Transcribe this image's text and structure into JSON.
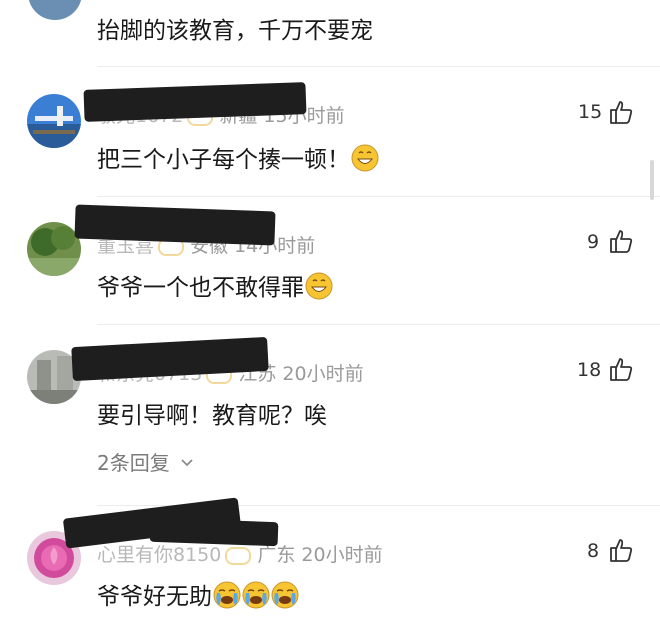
{
  "prev_comment": {
    "text": "抬脚的该教育，千万不要宠"
  },
  "comments": [
    {
      "name": "敏光1672",
      "location": "新疆",
      "time": "15小时前",
      "text": "把三个小子每个揍一顿！",
      "likes": "15"
    },
    {
      "name": "董玉喜",
      "location": "安徽",
      "time": "14小时前",
      "text": "爷爷一个也不敢得罪",
      "likes": "9"
    },
    {
      "name": "和东亮0713",
      "location": "江苏",
      "time": "20小时前",
      "text": "要引导啊！教育呢？唉",
      "likes": "18",
      "replies": "2条回复"
    },
    {
      "name": "心里有你8150",
      "location": "广东",
      "time": "20小时前",
      "text": "爷爷好无助",
      "likes": "8"
    }
  ],
  "colors": {
    "text": "#1a1a1a",
    "meta": "#9a9a9a",
    "divider": "#ececec",
    "redaction": "#1e1e1e",
    "emoji": "#f7c531"
  }
}
